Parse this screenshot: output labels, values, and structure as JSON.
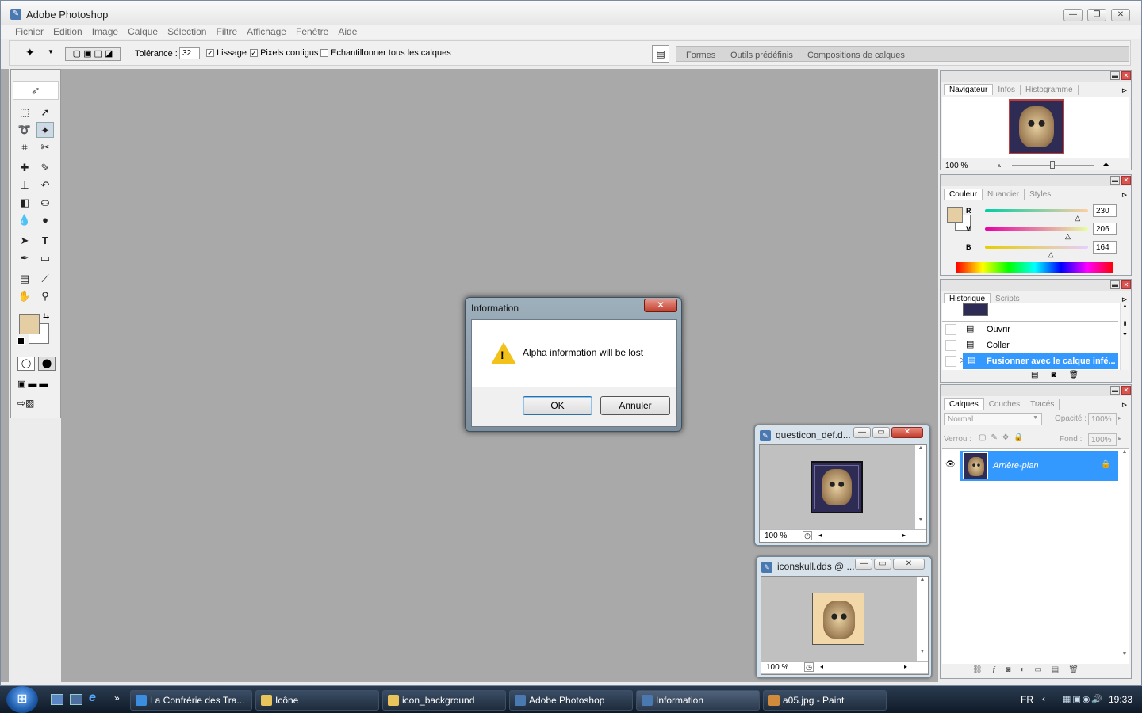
{
  "app": {
    "title": "Adobe Photoshop"
  },
  "menu": [
    "Fichier",
    "Edition",
    "Image",
    "Calque",
    "Sélection",
    "Filtre",
    "Affichage",
    "Fenêtre",
    "Aide"
  ],
  "options": {
    "tolerance_label": "Tolérance :",
    "tolerance_value": "32",
    "lissage": "Lissage",
    "pixels_contigus": "Pixels contigus",
    "echantillonner": "Echantillonner tous les calques",
    "well_tabs": [
      "Formes",
      "Outils prédéfinis",
      "Compositions de calques"
    ]
  },
  "navigator": {
    "tabs": [
      "Navigateur",
      "Infos",
      "Histogramme"
    ],
    "zoom": "100 %"
  },
  "color": {
    "tabs": [
      "Couleur",
      "Nuancier",
      "Styles"
    ],
    "r_label": "R",
    "r": "230",
    "r_fraction": 0.902,
    "v_label": "V",
    "v": "206",
    "v_fraction": 0.808,
    "b_label": "B",
    "b": "164",
    "b_fraction": 0.643,
    "foreground": "#e6cea4"
  },
  "history": {
    "tabs": [
      "Historique",
      "Scripts"
    ],
    "items": [
      "Ouvrir",
      "Coller",
      "Fusionner avec le calque infé..."
    ]
  },
  "layers": {
    "tabs": [
      "Calques",
      "Couches",
      "Tracés"
    ],
    "mode": "Normal",
    "opacity_label": "Opacité :",
    "opacity": "100%",
    "lock_label": "Verrou :",
    "fill_label": "Fond :",
    "fill": "100%",
    "layer_name": "Arrière-plan"
  },
  "doc1": {
    "title": "questicon_def.d...",
    "zoom": "100 %"
  },
  "doc2": {
    "title": "iconskull.dds @ ...",
    "zoom": "100 %"
  },
  "dialog": {
    "title": "Information",
    "message": "Alpha information will be lost",
    "ok": "OK",
    "cancel": "Annuler"
  },
  "taskbar": {
    "items": [
      "La Confrérie des Tra...",
      "Icône",
      "icon_background",
      "Adobe Photoshop",
      "Information",
      "a05.jpg - Paint"
    ],
    "lang": "FR",
    "clock": "19:33",
    "more": "»"
  },
  "colors": {
    "selection": "#3399ff",
    "accent": "#e6cea4"
  }
}
